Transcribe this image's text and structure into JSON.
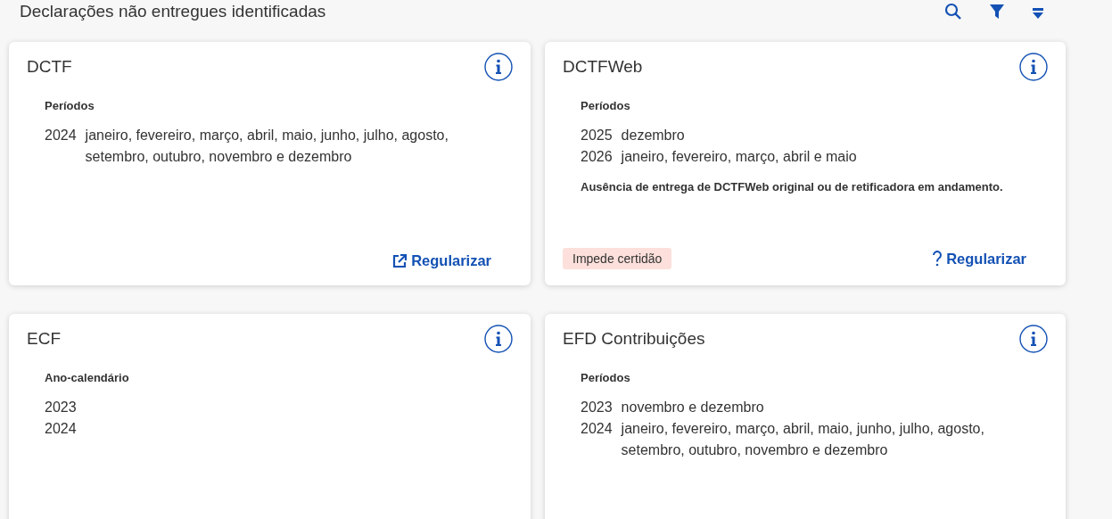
{
  "page": {
    "title": "Declarações não entregues identificadas",
    "toolbar": [
      {
        "kind": "search"
      },
      {
        "kind": "filter"
      },
      {
        "kind": "sort"
      }
    ]
  },
  "cards": [
    {
      "title": "DCTF",
      "section_label": "Períodos",
      "periods": [
        {
          "year": "2024",
          "months": "janeiro, fevereiro, março, abril, maio, junho, julho, agosto, setembro, outubro, novembro e dezembro"
        }
      ],
      "action": {
        "label": "Regularizar",
        "kind": "external"
      }
    },
    {
      "title": "DCTFWeb",
      "section_label": "Períodos",
      "periods": [
        {
          "year": "2025",
          "months": "dezembro"
        },
        {
          "year": "2026",
          "months": "janeiro, fevereiro, março, abril e maio"
        }
      ],
      "note": "Ausência de entrega de DCTFWeb original ou de retificadora em andamento.",
      "badge": "Impede certidão",
      "action": {
        "label": "Regularizar",
        "kind": "help"
      }
    },
    {
      "title": "ECF",
      "section_label": "Ano-calendário",
      "periods": [
        {
          "year": "2023"
        },
        {
          "year": "2024"
        }
      ]
    },
    {
      "title": "EFD Contribuições",
      "section_label": "Períodos",
      "periods": [
        {
          "year": "2023",
          "months": "novembro e dezembro"
        },
        {
          "year": "2024",
          "months": "janeiro, fevereiro, março, abril, maio, junho, julho, agosto, setembro, outubro, novembro e dezembro"
        }
      ]
    }
  ]
}
